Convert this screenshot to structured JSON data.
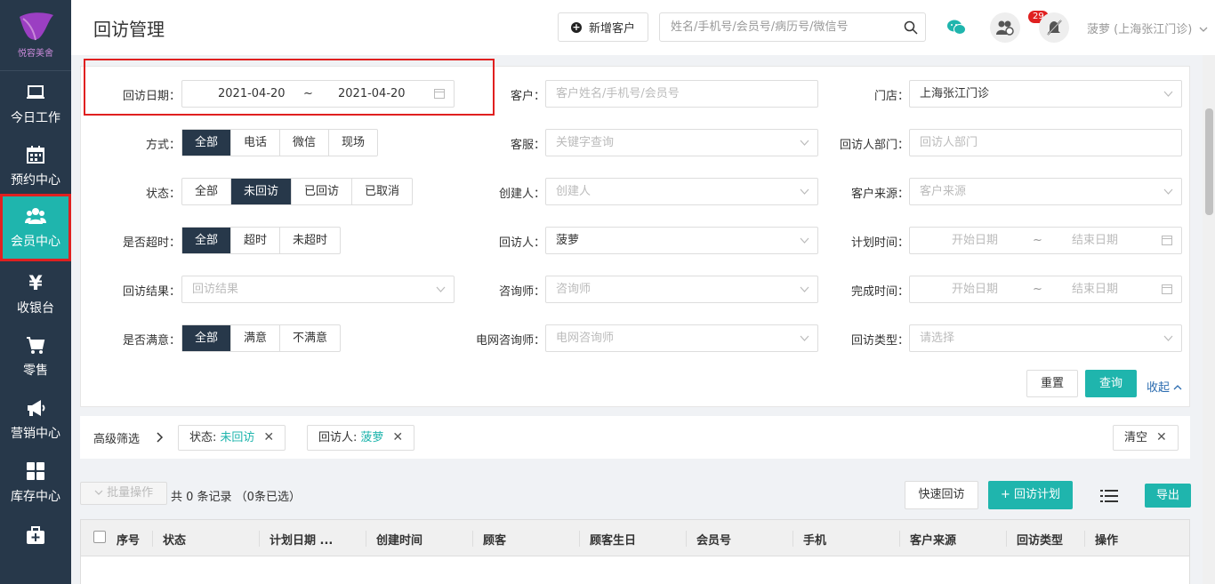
{
  "sidebar": {
    "logo_text": "悦容美舍",
    "items": [
      {
        "label": "今日工作",
        "icon": "laptop-icon"
      },
      {
        "label": "预约中心",
        "icon": "calendar-icon"
      },
      {
        "label": "会员中心",
        "icon": "users-icon",
        "active": true
      },
      {
        "label": "收银台",
        "icon": "yen-icon"
      },
      {
        "label": "零售",
        "icon": "cart-icon"
      },
      {
        "label": "营销中心",
        "icon": "megaphone-icon"
      },
      {
        "label": "库存中心",
        "icon": "grid-icon"
      },
      {
        "label": "",
        "icon": "medkit-icon"
      }
    ]
  },
  "header": {
    "title": "回访管理",
    "new_customer": "新增客户",
    "search_placeholder": "姓名/手机号/会员号/病历号/微信号",
    "badge_count": "29",
    "user": "菠萝 (上海张江门诊)"
  },
  "filters": {
    "visit_date_label": "回访日期：",
    "visit_date_start": "2021-04-20",
    "visit_date_sep": "~",
    "visit_date_end": "2021-04-20",
    "customer_label": "客户：",
    "customer_placeholder": "客户姓名/手机号/会员号",
    "store_label": "门店：",
    "store_value": "上海张江门诊",
    "method_label": "方式：",
    "method_options": [
      "全部",
      "电话",
      "微信",
      "现场"
    ],
    "service_label": "客服：",
    "service_placeholder": "关键字查询",
    "dept_label": "回访人部门：",
    "dept_placeholder": "回访人部门",
    "status_label": "状态：",
    "status_options": [
      "全部",
      "未回访",
      "已回访",
      "已取消"
    ],
    "creator_label": "创建人：",
    "creator_placeholder": "创建人",
    "source_label": "客户来源：",
    "source_placeholder": "客户来源",
    "overtime_label": "是否超时：",
    "overtime_options": [
      "全部",
      "超时",
      "未超时"
    ],
    "visitor_label": "回访人：",
    "visitor_value": "菠萝",
    "plan_time_label": "计划时间：",
    "start_placeholder": "开始日期",
    "end_placeholder": "结束日期",
    "result_label": "回访结果：",
    "result_placeholder": "回访结果",
    "consultant_label": "咨询师：",
    "consultant_placeholder": "咨询师",
    "finish_time_label": "完成时间：",
    "satisfied_label": "是否满意：",
    "satisfied_options": [
      "全部",
      "满意",
      "不满意"
    ],
    "net_consultant_label": "电网咨询师：",
    "net_consultant_placeholder": "电网咨询师",
    "visit_type_label": "回访类型：",
    "visit_type_placeholder": "请选择",
    "reset": "重置",
    "query": "查询",
    "collapse": "收起"
  },
  "advanced": {
    "title": "高级筛选",
    "tag1_key": "状态:",
    "tag1_val": "未回访",
    "tag2_key": "回访人:",
    "tag2_val": "菠萝",
    "clear": "清空"
  },
  "list": {
    "batch": "批量操作",
    "count": "共 0 条记录  （0条已选）",
    "quick_visit": "快速回访",
    "add_plan": "+ 回访计划",
    "export": "导出",
    "columns": [
      "序号",
      "状态",
      "计划日期 ...",
      "创建时间",
      "顾客",
      "顾客生日",
      "会员号",
      "手机",
      "客户来源",
      "回访类型",
      "操作"
    ]
  },
  "colors": {
    "sidebar": "#27384a",
    "accent": "#1fb5ad",
    "highlight": "#e02020"
  }
}
